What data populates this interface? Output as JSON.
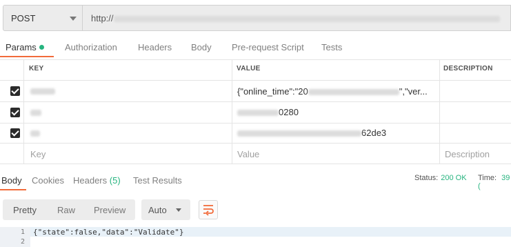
{
  "request": {
    "method": "POST",
    "url": "http://"
  },
  "request_tabs": [
    {
      "label": "Params"
    },
    {
      "label": "Authorization"
    },
    {
      "label": "Headers"
    },
    {
      "label": "Body"
    },
    {
      "label": "Pre-request Script"
    },
    {
      "label": "Tests"
    }
  ],
  "params_table": {
    "headers": {
      "key": "KEY",
      "value": "VALUE",
      "description": "DESCRIPTION"
    },
    "rows": [
      {
        "value_prefix": "{\"online_time\":\"20",
        "value_suffix": "\",\"ver..."
      },
      {
        "value_suffix": "0280"
      },
      {
        "value_suffix": "62de3"
      }
    ],
    "placeholders": {
      "key": "Key",
      "value": "Value",
      "description": "Description"
    }
  },
  "response_tabs": {
    "body": "Body",
    "cookies": "Cookies",
    "headers": "Headers",
    "headers_count": "(5)",
    "test_results": "Test Results"
  },
  "status": {
    "status_label": "Status:",
    "status_value": "200 OK",
    "time_label": "Time:",
    "time_value": "39 ("
  },
  "toolbar": {
    "pretty": "Pretty",
    "raw": "Raw",
    "preview": "Preview",
    "format": "Auto"
  },
  "code": {
    "lines": [
      {
        "number": "1",
        "text": "{\"state\":false,\"data\":\"Validate\"}"
      },
      {
        "number": "2",
        "text": ""
      }
    ]
  },
  "colors": {
    "accent": "#f26b3a",
    "success": "#26b47f"
  }
}
